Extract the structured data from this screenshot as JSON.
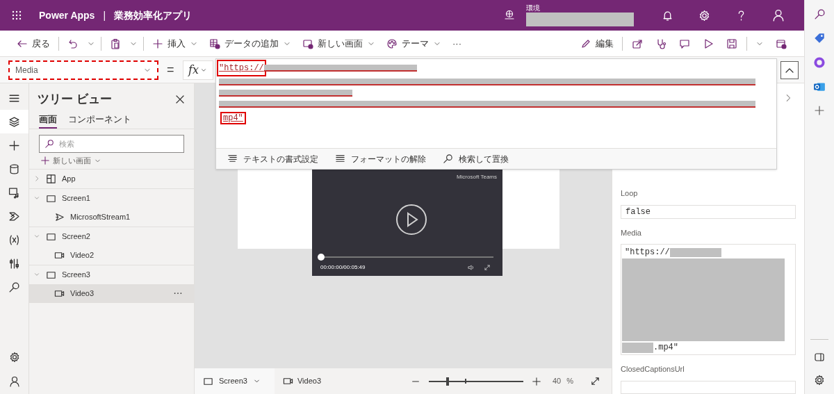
{
  "header": {
    "app_name": "Power Apps",
    "separator": "|",
    "app_title": "業務効率化アプリ",
    "environment_label": "環境"
  },
  "toolbar": {
    "left": [
      {
        "kind": "back",
        "label": "戻る"
      },
      {
        "kind": "undo"
      },
      {
        "kind": "chevron"
      },
      {
        "kind": "paste"
      },
      {
        "kind": "chevron"
      },
      {
        "kind": "insert",
        "label": "挿入"
      },
      {
        "kind": "data",
        "label": "データの追加"
      },
      {
        "kind": "screen",
        "label": "新しい画面"
      },
      {
        "kind": "theme",
        "label": "テーマ"
      },
      {
        "kind": "more",
        "label": "···"
      }
    ],
    "right": [
      {
        "kind": "edit",
        "label": "編集"
      },
      {
        "kind": "share"
      },
      {
        "kind": "checker"
      },
      {
        "kind": "comment"
      },
      {
        "kind": "play"
      },
      {
        "kind": "save"
      },
      {
        "kind": "chevron"
      },
      {
        "kind": "publish"
      }
    ]
  },
  "formula_bar": {
    "property": "Media",
    "equals": "=",
    "fx": "fx",
    "first_line": "\"https://",
    "last_line": "mp4\"",
    "tools": [
      {
        "kind": "format",
        "label": "テキストの書式設定"
      },
      {
        "kind": "clear",
        "label": "フォーマットの解除"
      },
      {
        "kind": "search",
        "label": "検索して置換"
      }
    ]
  },
  "tree_view": {
    "title": "ツリー ビュー",
    "tabs": [
      {
        "label": "画面",
        "selected": true
      },
      {
        "label": "コンポーネント",
        "selected": false
      }
    ],
    "search": {
      "placeholder": "検索"
    },
    "new_screen": "新しい画面",
    "items": [
      {
        "kind": "app",
        "label": "App",
        "expanded": false,
        "selected": false
      },
      {
        "kind": "screen",
        "label": "Screen1",
        "expanded": true,
        "selected": false,
        "children": [
          {
            "kind": "stream",
            "label": "MicrosoftStream1",
            "selected": false
          }
        ]
      },
      {
        "kind": "screen",
        "label": "Screen2",
        "expanded": true,
        "selected": false,
        "children": [
          {
            "kind": "video",
            "label": "Video2",
            "selected": false
          }
        ]
      },
      {
        "kind": "screen",
        "label": "Screen3",
        "expanded": true,
        "selected": false,
        "children": [
          {
            "kind": "video",
            "label": "Video3",
            "selected": true
          }
        ]
      }
    ]
  },
  "video": {
    "brand": "Microsoft Teams",
    "time": "00:00:00/00:05:49",
    "level": 0
  },
  "properties": [
    {
      "kind": "text",
      "label": "Loop",
      "value": "false"
    },
    {
      "kind": "media",
      "label": "Media",
      "first_line": "\"https://",
      "last_line": ".mp4\""
    },
    {
      "kind": "text",
      "label": "ClosedCaptionsUrl"
    }
  ],
  "status_bar": {
    "screen": "Screen3",
    "control": "Video3",
    "zoom": {
      "level": 0.2,
      "value": "40",
      "unit": "%"
    }
  }
}
